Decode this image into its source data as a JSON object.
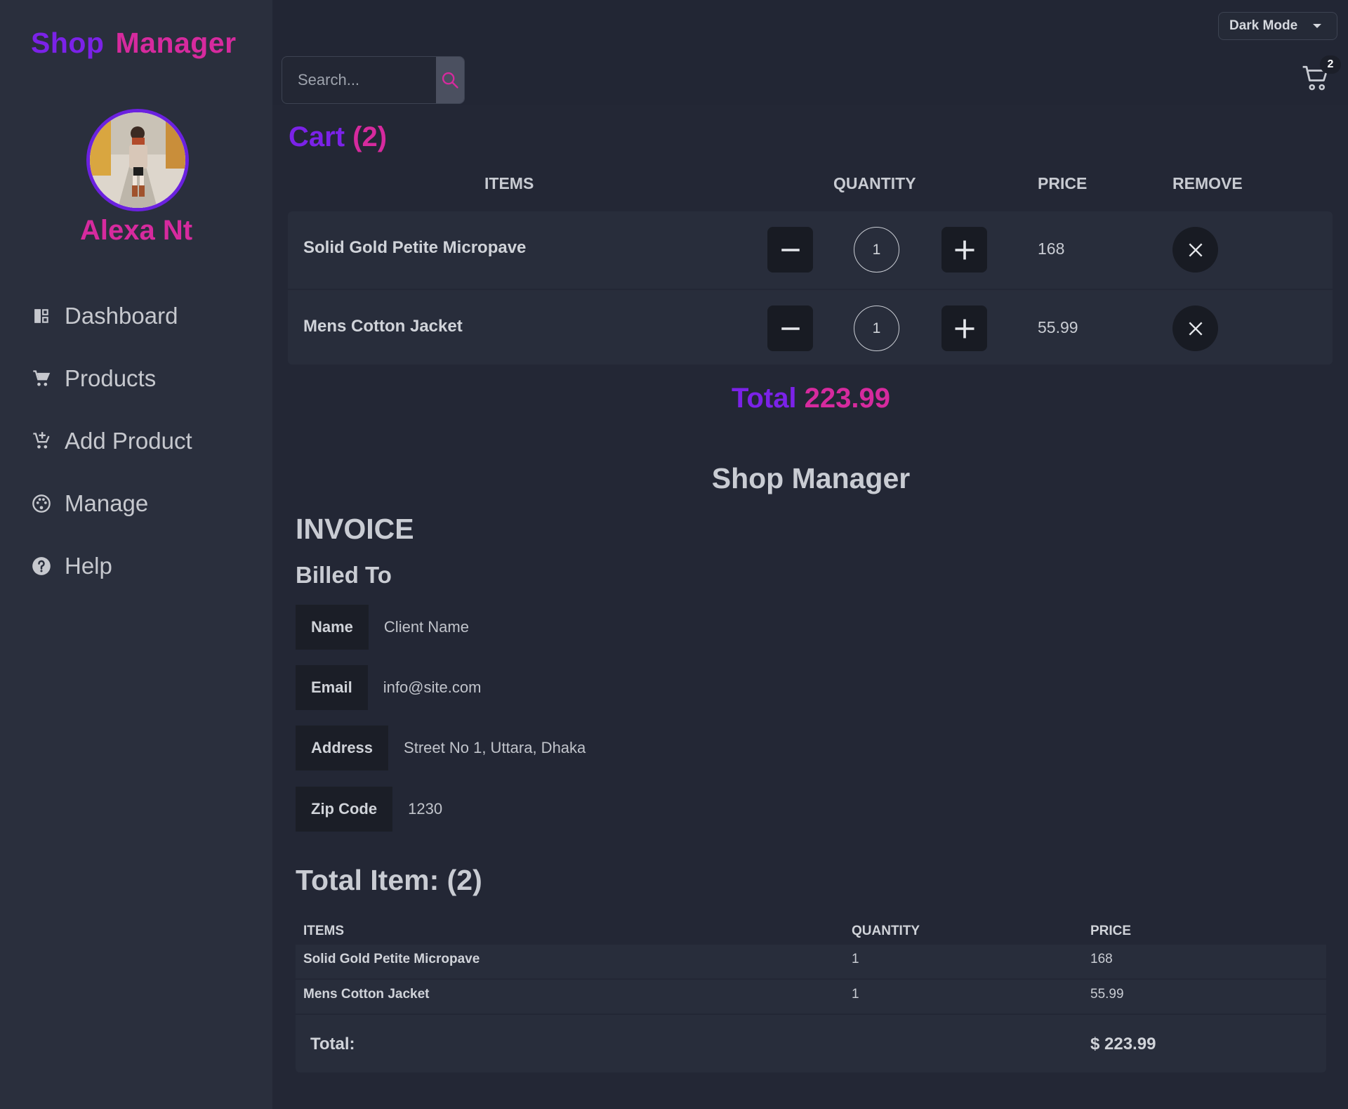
{
  "brand": {
    "word1": "Shop",
    "word2": "Manager"
  },
  "user": {
    "name": "Alexa Nt"
  },
  "nav": [
    {
      "label": "Dashboard",
      "icon": "dashboard-icon"
    },
    {
      "label": "Products",
      "icon": "cart-icon"
    },
    {
      "label": "Add Product",
      "icon": "add-cart-icon"
    },
    {
      "label": "Manage",
      "icon": "palette-icon"
    },
    {
      "label": "Help",
      "icon": "help-icon"
    }
  ],
  "search": {
    "placeholder": "Search..."
  },
  "theme": {
    "selected": "Dark Mode"
  },
  "cart_badge": "2",
  "cart": {
    "title_word": "Cart",
    "title_count": "(2)",
    "headers": {
      "items": "ITEMS",
      "quantity": "QUANTITY",
      "price": "PRICE",
      "remove": "REMOVE"
    },
    "items": [
      {
        "name": "Solid Gold Petite Micropave",
        "qty": "1",
        "price": "168"
      },
      {
        "name": "Mens Cotton Jacket",
        "qty": "1",
        "price": "55.99"
      }
    ],
    "total_label": "Total",
    "total_value": "223.99"
  },
  "invoice": {
    "brand": "Shop Manager",
    "title": "INVOICE",
    "billed_to": "Billed To",
    "fields": [
      {
        "label": "Name",
        "value": "Client Name"
      },
      {
        "label": "Email",
        "value": "info@site.com"
      },
      {
        "label": "Address",
        "value": "Street No 1, Uttara, Dhaka"
      },
      {
        "label": "Zip Code",
        "value": "1230"
      }
    ],
    "total_items": "Total Item: (2)",
    "table_headers": {
      "items": "ITEMS",
      "quantity": "QUANTITY",
      "price": "PRICE"
    },
    "rows": [
      {
        "name": "Solid Gold Petite Micropave",
        "qty": "1",
        "price": "168"
      },
      {
        "name": "Mens Cotton Jacket",
        "qty": "1",
        "price": "55.99"
      }
    ],
    "footer_label": "Total:",
    "footer_value": "$ 223.99"
  },
  "colors": {
    "purple": "#7b22e8",
    "pink": "#d62a9e",
    "sidebar": "#2a2f3d",
    "background": "#222634"
  }
}
